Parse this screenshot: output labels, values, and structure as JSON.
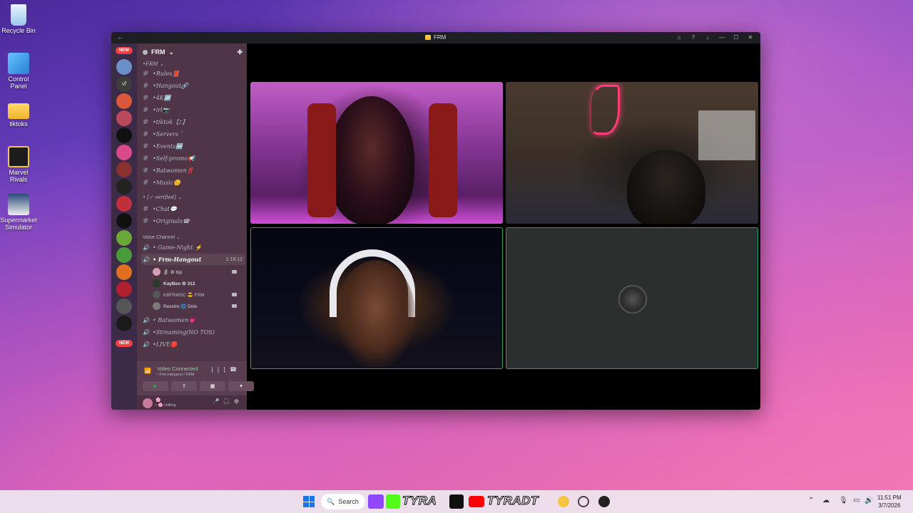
{
  "desktop": {
    "icons": [
      {
        "label": "Recycle Bin"
      },
      {
        "label": "Control Panel"
      },
      {
        "label": "tiktoks"
      },
      {
        "label": "Marvel Rivals"
      },
      {
        "label": "Supermarket Simulator"
      }
    ]
  },
  "window": {
    "title": "FRM",
    "back": "←",
    "controls": [
      "⌂",
      "?",
      "↓",
      "—",
      "☐",
      "✕"
    ]
  },
  "rail": {
    "badge_top": "NEW",
    "badge_bottom": "NEW",
    "vf": "vf"
  },
  "server": {
    "name": "FRM",
    "chevron": "⌄",
    "add_user": "✚"
  },
  "categories": {
    "frm": "•FRM ⌄",
    "verified": "• [✓ verified] ⌄",
    "voice": "Voice Channel ⌄"
  },
  "text_channels": [
    {
      "name": "•Rules📕"
    },
    {
      "name": "•Hangout🔗"
    },
    {
      "name": "•4K🆙"
    },
    {
      "name": "•irl📷"
    },
    {
      "name": "•tiktok【♪】"
    },
    {
      "name": "•Servers ˘"
    },
    {
      "name": "•Events🆕"
    },
    {
      "name": "•Self-promo📢"
    },
    {
      "name": "•Batwomen‼️"
    },
    {
      "name": "•Music😊"
    },
    {
      "name": "•Chat💬"
    },
    {
      "name": "•Originals☎"
    }
  ],
  "voice_channels": [
    {
      "name": "• Game-Night ⚡"
    },
    {
      "name": "• Frm-Hangout",
      "timer": "1:18:12"
    },
    {
      "name": "• Batwomen💗"
    },
    {
      "name": "•Streaming(NO TOS)"
    },
    {
      "name": "•LIVE🔴"
    }
  ],
  "voice_users": [
    {
      "name": "🗿 ⚙ bip"
    },
    {
      "name": "KayBeo ⚙ 312"
    },
    {
      "name": "KBFRMSC 😎 FRM"
    },
    {
      "name": "Rexstro 🌐 Dolo"
    }
  ],
  "voice_panel": {
    "status": "Video Connected",
    "sub": "• Frm-Hangout / FRM",
    "buttons": [
      "▶",
      "⇪",
      "▦",
      "✦"
    ]
  },
  "user": {
    "name": "🌸",
    "status": "• 🌸 chilling"
  },
  "taskbar": {
    "search": "Search",
    "brand1": "TYRA",
    "brand2": "TYRADT",
    "time": "11:51 PM",
    "date": "3/7/2026"
  },
  "colors": {
    "accent_green": "#23a55a",
    "badge_red": "#f23f43"
  }
}
